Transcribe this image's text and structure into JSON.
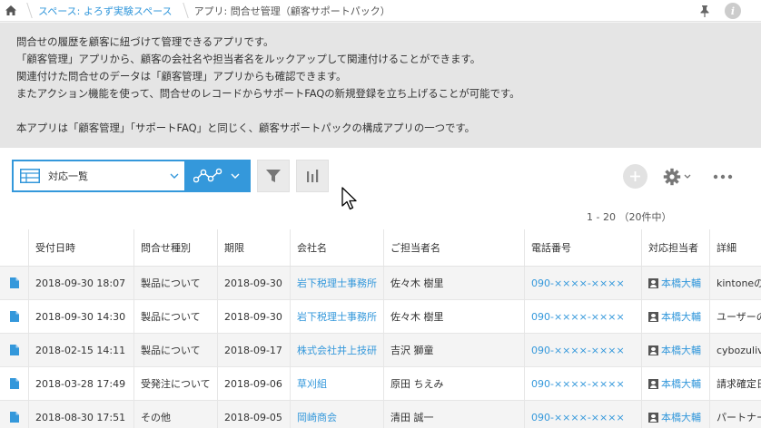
{
  "breadcrumb": {
    "space": "スペース: よろず実験スペース",
    "app": "アプリ: 問合せ管理（顧客サポートパック）"
  },
  "info_label": "i",
  "description": [
    "問合せの履歴を顧客に紐づけて管理できるアプリです。",
    "「顧客管理」アプリから、顧客の会社名や担当者名をルックアップして関連付けることができます。",
    "関連付けた問合せのデータは「顧客管理」アプリからも確認できます。",
    "またアクション機能を使って、問合せのレコードからサポートFAQの新規登録を立ち上げることが可能です。",
    "本アプリは「顧客管理」「サポートFAQ」と同じく、顧客サポートパックの構成アプリの一つです。"
  ],
  "toolbar": {
    "view_name": "対応一覧"
  },
  "pagination": "1 - 20 （20件中）",
  "table": {
    "columns": [
      "受付日時",
      "問合せ種別",
      "期限",
      "会社名",
      "ご担当者名",
      "電話番号",
      "対応担当者",
      "詳細"
    ],
    "rows": [
      [
        "2018-09-30 18:07",
        "製品について",
        "2018-09-30",
        "岩下税理士事務所",
        "佐々木 樹里",
        "090-××××-××××",
        "本橋大輔",
        "kintoneの"
      ],
      [
        "2018-09-30 14:30",
        "製品について",
        "2018-09-30",
        "岩下税理士事務所",
        "佐々木 樹里",
        "090-××××-××××",
        "本橋大輔",
        "ユーザーの"
      ],
      [
        "2018-02-15 14:11",
        "製品について",
        "2018-09-17",
        "株式会社井上技研",
        "吉沢 獅童",
        "090-××××-××××",
        "本橋大輔",
        "cybozuliv"
      ],
      [
        "2018-03-28 17:49",
        "受発注について",
        "2018-09-06",
        "草刈組",
        "原田 ちえみ",
        "090-××××-××××",
        "本橋大輔",
        "請求確定日"
      ],
      [
        "2018-08-30 17:51",
        "その他",
        "2018-09-05",
        "岡崎商会",
        "清田 誠一",
        "090-××××-××××",
        "本橋大輔",
        "パートナー"
      ]
    ]
  },
  "colors": {
    "accent": "#3498db",
    "description_bg": "#e5e5e5"
  }
}
